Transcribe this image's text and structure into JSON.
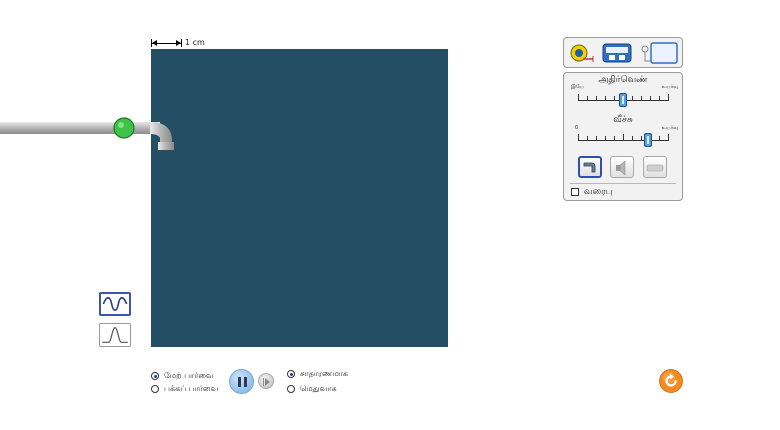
{
  "scale": {
    "label": "1 cm"
  },
  "panel": {
    "frequency": {
      "title": "அதிர்வெண்",
      "min_label": "இயே",
      "max_label": "உயர்வு",
      "value_fraction": 0.5
    },
    "amplitude": {
      "title": "வீச்சு",
      "min_label": "0",
      "max_label": "உயர்வு",
      "value_fraction": 0.78
    },
    "graph_checkbox": {
      "label": "வரைபு",
      "checked": false
    }
  },
  "bottom": {
    "view_top": "மேற் பார்வை",
    "view_side": "பக்கப் பார்வை",
    "speed_normal": "சாதாரணமாக",
    "speed_slow": "மெதுவாக"
  },
  "colors": {
    "water": "#244e63",
    "accent": "#3a55b0",
    "faucet_valve": "#3fc247",
    "reset": "#f58a1f"
  },
  "icons": [
    "measuring-tape-icon",
    "stopwatch-icon",
    "probe-icon",
    "faucet-icon",
    "speaker-icon",
    "laser-icon",
    "sine-wave-icon",
    "pulse-wave-icon",
    "pause-icon",
    "step-forward-icon",
    "reset-icon"
  ]
}
